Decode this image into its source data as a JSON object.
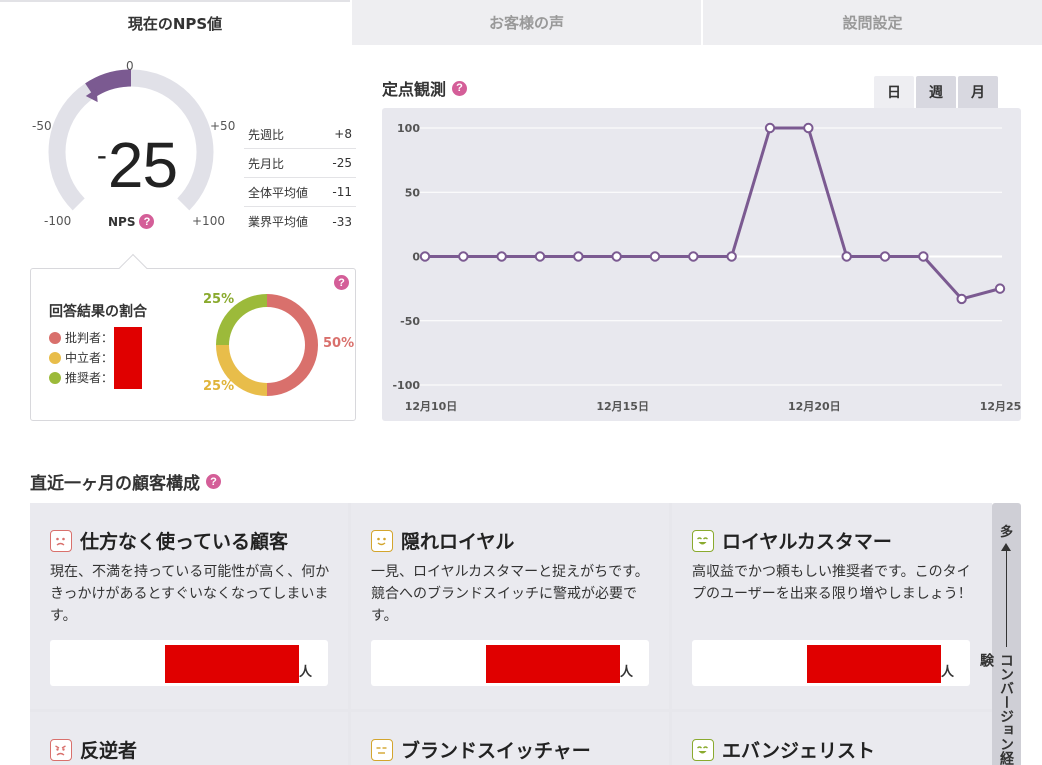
{
  "tabs": [
    {
      "label": "現在のNPS値",
      "active": true
    },
    {
      "label": "お客様の声",
      "active": false
    },
    {
      "label": "設問設定",
      "active": false
    }
  ],
  "gauge": {
    "value": "25",
    "sign": "-",
    "score": -25,
    "label": "NPS",
    "help": "?",
    "ticks": {
      "top": "0",
      "upper_left": "-50",
      "upper_right": "+50",
      "lower_left": "-100",
      "lower_right": "+100"
    }
  },
  "compare": [
    {
      "label": "先週比",
      "value": "+8"
    },
    {
      "label": "先月比",
      "value": "-25"
    },
    {
      "label": "全体平均値",
      "value": "-11"
    },
    {
      "label": "業界平均値",
      "value": "-33"
    }
  ],
  "breakdown": {
    "title": "回答結果の割合",
    "help": "?",
    "legend": [
      {
        "label": "批判者：",
        "color": "#d9706c"
      },
      {
        "label": "中立者：",
        "color": "#e8bd4a"
      },
      {
        "label": "推奨者：",
        "color": "#9cba3a"
      }
    ],
    "donut": [
      {
        "label": "50%",
        "value": 50,
        "color": "#d9706c"
      },
      {
        "label": "25%",
        "value": 25,
        "color": "#e8bd4a"
      },
      {
        "label": "25%",
        "value": 25,
        "color": "#9cba3a"
      }
    ]
  },
  "fixed_point": {
    "title": "定点観測",
    "help": "?",
    "periods": [
      {
        "label": "日",
        "active": true
      },
      {
        "label": "週",
        "active": false
      },
      {
        "label": "月",
        "active": false
      }
    ]
  },
  "chart_data": {
    "type": "line",
    "x": [
      "12月10日",
      "12月11日",
      "12月12日",
      "12月13日",
      "12月14日",
      "12月15日",
      "12月16日",
      "12月17日",
      "12月18日",
      "12月19日",
      "12月20日",
      "12月21日",
      "12月22日",
      "12月23日",
      "12月24日",
      "12月25日"
    ],
    "x_tick_labels": [
      "12月10日",
      "12月15日",
      "12月20日",
      "12月25日"
    ],
    "series": [
      {
        "values": [
          0,
          0,
          0,
          0,
          0,
          0,
          0,
          0,
          0,
          100,
          100,
          0,
          0,
          0,
          -33,
          -25
        ],
        "color": "#7b5a91"
      }
    ],
    "ylim": [
      -100,
      100
    ],
    "y_ticks": [
      "100",
      "50",
      "0",
      "-50",
      "-100"
    ],
    "grid": true
  },
  "composition": {
    "title": "直近一ヶ月の顧客構成",
    "help": "?",
    "cards": [
      {
        "title": "仕方なく使っている顧客",
        "desc": "現在、不満を持っている可能性が高く、何かきっかけがあるとすぐいなくなってしまいます。",
        "unit": "人",
        "face_color": "#d9706c",
        "face_icon": "frown-face-icon"
      },
      {
        "title": "隠れロイヤル",
        "desc": "一見、ロイヤルカスタマーと捉えがちです。競合へのブランドスイッチに警戒が必要です。",
        "unit": "人",
        "face_color": "#d3a52d",
        "face_icon": "smile-face-icon"
      },
      {
        "title": "ロイヤルカスタマー",
        "desc": "高収益でかつ頼もしい推奨者です。このタイプのユーザーを出来る限り増やしましょう！",
        "unit": "人",
        "face_color": "#8aaa2e",
        "face_icon": "grin-face-icon"
      },
      {
        "title": "反逆者",
        "face_color": "#d9706c",
        "face_icon": "angry-face-icon"
      },
      {
        "title": "ブランドスイッチャー",
        "face_color": "#d3a52d",
        "face_icon": "neutral-face-icon"
      },
      {
        "title": "エバンジェリスト",
        "face_color": "#8aaa2e",
        "face_icon": "grin-face-icon"
      }
    ],
    "scale": {
      "top": "多",
      "axis_label": "コンバージョン経験"
    }
  }
}
